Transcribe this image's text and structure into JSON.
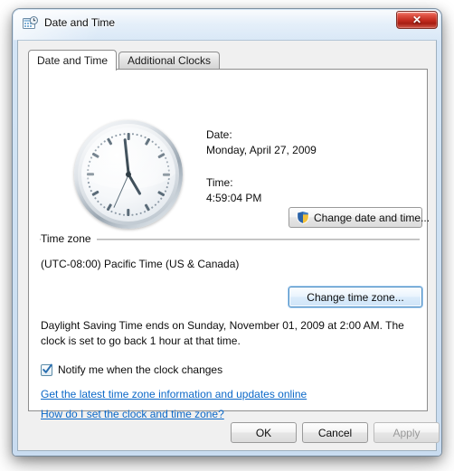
{
  "window": {
    "title": "Date and Time",
    "icon": "calendar-clock-icon",
    "close_glyph": "✕",
    "frame_color": "#cfe2f4",
    "client_bg": "#f0f0f0"
  },
  "tabs": [
    {
      "label": "Date and Time",
      "active": true
    },
    {
      "label": "Additional Clocks",
      "active": false
    }
  ],
  "clock": {
    "name": "analog-clock",
    "hour": 4,
    "minute": 59,
    "second": 4,
    "hour_angle": 149.5,
    "minute_angle": 354,
    "second_angle": 204
  },
  "datetime": {
    "date_label": "Date:",
    "date_value": "Monday, April 27, 2009",
    "time_label": "Time:",
    "time_value": "4:59:04 PM"
  },
  "buttons": {
    "change_datetime": "Change date and time...",
    "change_timezone": "Change time zone...",
    "ok": "OK",
    "cancel": "Cancel",
    "apply": "Apply"
  },
  "timezone_group": {
    "legend": "Time zone",
    "value": "(UTC-08:00) Pacific Time (US & Canada)"
  },
  "dst": {
    "text": "Daylight Saving Time ends on Sunday, November 01, 2009 at 2:00 AM. The clock is set to go back 1 hour at that time."
  },
  "notify": {
    "label": "Notify me when the clock changes",
    "checked": true
  },
  "links": {
    "timezone_info": "Get the latest time zone information and updates online",
    "how_to": "How do I set the clock and time zone?",
    "color": "#0b68c8"
  },
  "colors": {
    "link": "#0b68c8",
    "accent_default_button": "#4b8ec4",
    "close_button": "#c42d20",
    "shield_blue": "#2b63a8",
    "shield_yellow": "#f2c13c",
    "disabled_text": "#9a9a9a"
  }
}
